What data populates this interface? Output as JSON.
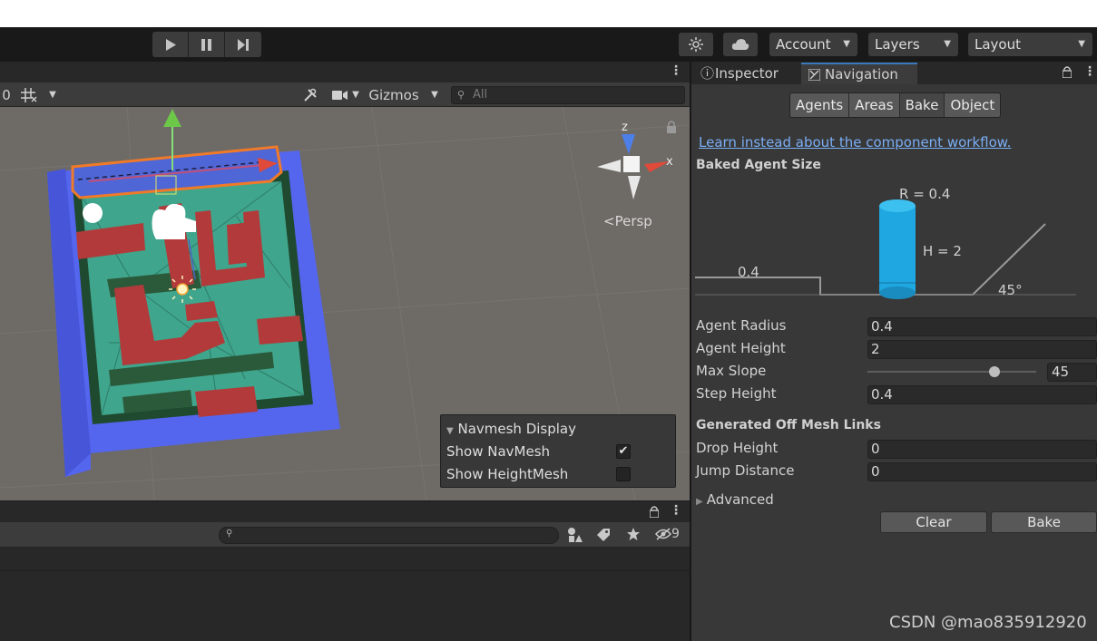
{
  "toolbar": {
    "account_label": "Account",
    "layers_label": "Layers",
    "layout_label": "Layout",
    "play_icon": "play-icon",
    "pause_icon": "pause-icon",
    "step_icon": "step-icon"
  },
  "scene": {
    "tools": {
      "left_number": "0",
      "gizmos_label": "Gizmos",
      "search_placeholder": "All"
    },
    "orientation": {
      "z_label": "z",
      "x_label": "x",
      "persp_label": "Persp"
    },
    "navmesh_display": {
      "title": "Navmesh Display",
      "show_navmesh_label": "Show NavMesh",
      "show_navmesh_checked": true,
      "show_heightmesh_label": "Show HeightMesh",
      "show_heightmesh_checked": false
    }
  },
  "bottom": {
    "hidden_count": "9"
  },
  "inspector": {
    "tabs": [
      {
        "label": "Inspector",
        "active": false
      },
      {
        "label": "Navigation",
        "active": true
      }
    ],
    "segments": [
      {
        "label": "Agents",
        "selected": false
      },
      {
        "label": "Areas",
        "selected": false
      },
      {
        "label": "Bake",
        "selected": true
      },
      {
        "label": "Object",
        "selected": false
      }
    ],
    "link_text": "Learn instead about the component workflow.",
    "baked_agent_size_title": "Baked Agent Size",
    "diagram": {
      "radius_label": "R = 0.4",
      "height_label": "H = 2",
      "step_label": "0.4",
      "slope_label": "45°"
    },
    "agent_radius": {
      "label": "Agent Radius",
      "value": "0.4"
    },
    "agent_height": {
      "label": "Agent Height",
      "value": "2"
    },
    "max_slope": {
      "label": "Max Slope",
      "value": "45",
      "fraction": 0.75
    },
    "step_height": {
      "label": "Step Height",
      "value": "0.4"
    },
    "off_mesh_title": "Generated Off Mesh Links",
    "drop_height": {
      "label": "Drop Height",
      "value": "0"
    },
    "jump_distance": {
      "label": "Jump Distance",
      "value": "0"
    },
    "advanced_label": "Advanced",
    "clear_label": "Clear",
    "bake_label": "Bake"
  },
  "watermark": "CSDN @mao835912920",
  "colors": {
    "accent": "#3a79bb",
    "link": "#7aaef5",
    "agent_cylinder": "#1ea7e0",
    "navmesh": "#3fa58c",
    "wall": "#b23a3a",
    "floor": "#5566ee",
    "selection": "#f07a28"
  }
}
